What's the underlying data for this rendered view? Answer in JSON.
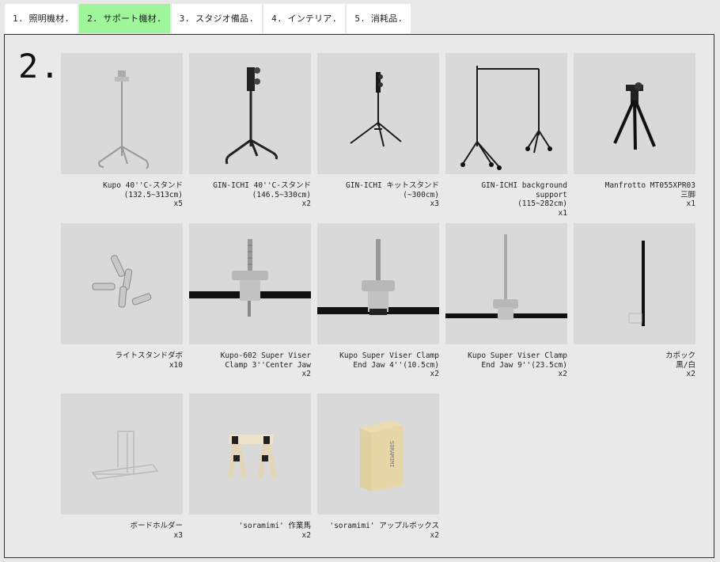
{
  "tabs": [
    {
      "label": "1. 照明機材.",
      "active": false
    },
    {
      "label": "2. サポート機材.",
      "active": true
    },
    {
      "label": "3. スタジオ備品.",
      "active": false
    },
    {
      "label": "4. インテリア.",
      "active": false
    },
    {
      "label": "5. 消耗品.",
      "active": false
    }
  ],
  "section": {
    "number": "2."
  },
  "colors": {
    "active_tab": "#9ff59a",
    "panel_bg": "#e9e9e9",
    "thumb_bg": "#d9d9d9"
  },
  "items": [
    {
      "name": "Kupo 40''C-スタンド",
      "spec": "(132.5~313cm)",
      "qty": "x5",
      "icon": "c-stand-silver-icon"
    },
    {
      "name": "GIN-ICHI 40''C-スタンド",
      "spec": "(146.5~330cm)",
      "qty": "x2",
      "icon": "c-stand-black-icon"
    },
    {
      "name": "GIN-ICHI キットスタンド",
      "spec": "(~300cm)",
      "qty": "x3",
      "icon": "kit-stand-icon"
    },
    {
      "name": "GIN-ICHI background support",
      "spec": "(115~282cm)",
      "qty": "x1",
      "icon": "background-support-icon"
    },
    {
      "name": "Manfrotto MT055XPR03",
      "spec": "三脚",
      "qty": "x1",
      "icon": "tripod-icon"
    },
    {
      "name": "ライトスタンドダボ",
      "spec": "",
      "qty": "x10",
      "icon": "spigot-icon"
    },
    {
      "name": "Kupo-602 Super Viser",
      "spec": "Clamp 3''Center Jaw",
      "qty": "x2",
      "icon": "clamp-center-icon"
    },
    {
      "name": "Kupo Super Viser Clamp",
      "spec": "End Jaw 4''(10.5cm)",
      "qty": "x2",
      "icon": "clamp-end-short-icon"
    },
    {
      "name": "Kupo Super Viser Clamp",
      "spec": "End Jaw 9''(23.5cm)",
      "qty": "x2",
      "icon": "clamp-end-long-icon"
    },
    {
      "name": "カポック",
      "spec": "黒/白",
      "qty": "x2",
      "icon": "kapok-board-icon"
    },
    {
      "name": "ボードホルダー",
      "spec": "",
      "qty": "x3",
      "icon": "board-holder-icon"
    },
    {
      "name": "'soramimi' 作業馬",
      "spec": "",
      "qty": "x2",
      "icon": "sawhorse-icon"
    },
    {
      "name": "'soramimi' アップルボックス",
      "spec": "",
      "qty": "x2",
      "icon": "apple-box-icon"
    }
  ]
}
